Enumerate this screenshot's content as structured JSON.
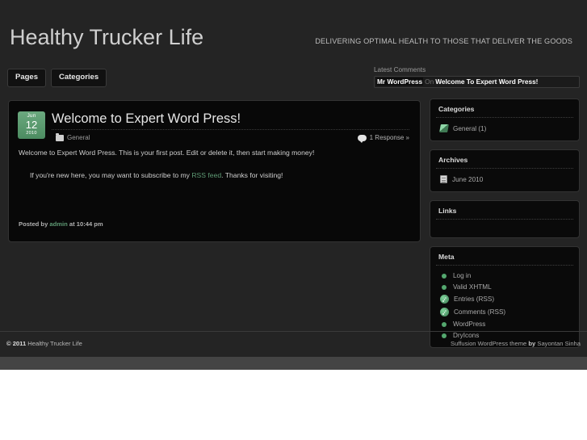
{
  "header": {
    "site_title": "Healthy Trucker Life",
    "tagline": "DELIVERING OPTIMAL HEALTH TO THOSE THAT DELIVER THE GOODS"
  },
  "nav": {
    "buttons": [
      {
        "label": "Pages"
      },
      {
        "label": "Categories"
      }
    ]
  },
  "latest_comments": {
    "title": "Latest Comments",
    "item": {
      "author": "Mr WordPress",
      "connector": "On",
      "post": "Welcome To Expert Word Press!"
    }
  },
  "post": {
    "date": {
      "month": "Jun",
      "day": "12",
      "year": "2010"
    },
    "title": "Welcome to Expert Word Press!",
    "category_icon": "folder-icon",
    "category": "General",
    "responses_icon": "comment-bubble-icon",
    "responses": "1 Response »",
    "paragraph_1": "Welcome to Expert Word Press. This is your first post. Edit or delete it, then start making money!",
    "paragraph_2_pre": "If you're new here, you may want to subscribe to my ",
    "paragraph_2_link": "RSS feed",
    "paragraph_2_post": ". Thanks for visiting!",
    "footer_pre": "Posted by ",
    "footer_author": "admin",
    "footer_post": " at 10:44 pm"
  },
  "sidebar": {
    "widgets": [
      {
        "title": "Categories",
        "items": [
          {
            "icon": "book-icon",
            "label": "General (1)"
          }
        ]
      },
      {
        "title": "Archives",
        "items": [
          {
            "icon": "calendar-icon",
            "label": "June 2010"
          }
        ]
      },
      {
        "title": "Links",
        "items": []
      },
      {
        "title": "Meta",
        "items": [
          {
            "icon": "bullet-dot-icon",
            "label": "Log in"
          },
          {
            "icon": "bullet-dot-icon",
            "label": "Valid XHTML"
          },
          {
            "icon": "rss-icon",
            "label": "Entries (RSS)"
          },
          {
            "icon": "rss-icon",
            "label": "Comments (RSS)"
          },
          {
            "icon": "bullet-dot-icon",
            "label": "WordPress"
          },
          {
            "icon": "bullet-dot-icon",
            "label": "DryIcons"
          }
        ]
      }
    ]
  },
  "footer": {
    "copyright_mark": "© 2011",
    "copyright_text": " Healthy Trucker Life",
    "credit_pre": "Suffusion WordPress theme ",
    "credit_bold": "by ",
    "credit_post": "Sayontan Sinha"
  },
  "colors": {
    "page_bg": "#242424",
    "panel_bg": "#080808",
    "panel_border": "#333333",
    "accent_green": "#5e9a74",
    "date_badge_green": "#4c8c61",
    "text_primary": "#cfcfcf",
    "text_muted": "#9a9a9a",
    "strip_gray": "#444444"
  }
}
